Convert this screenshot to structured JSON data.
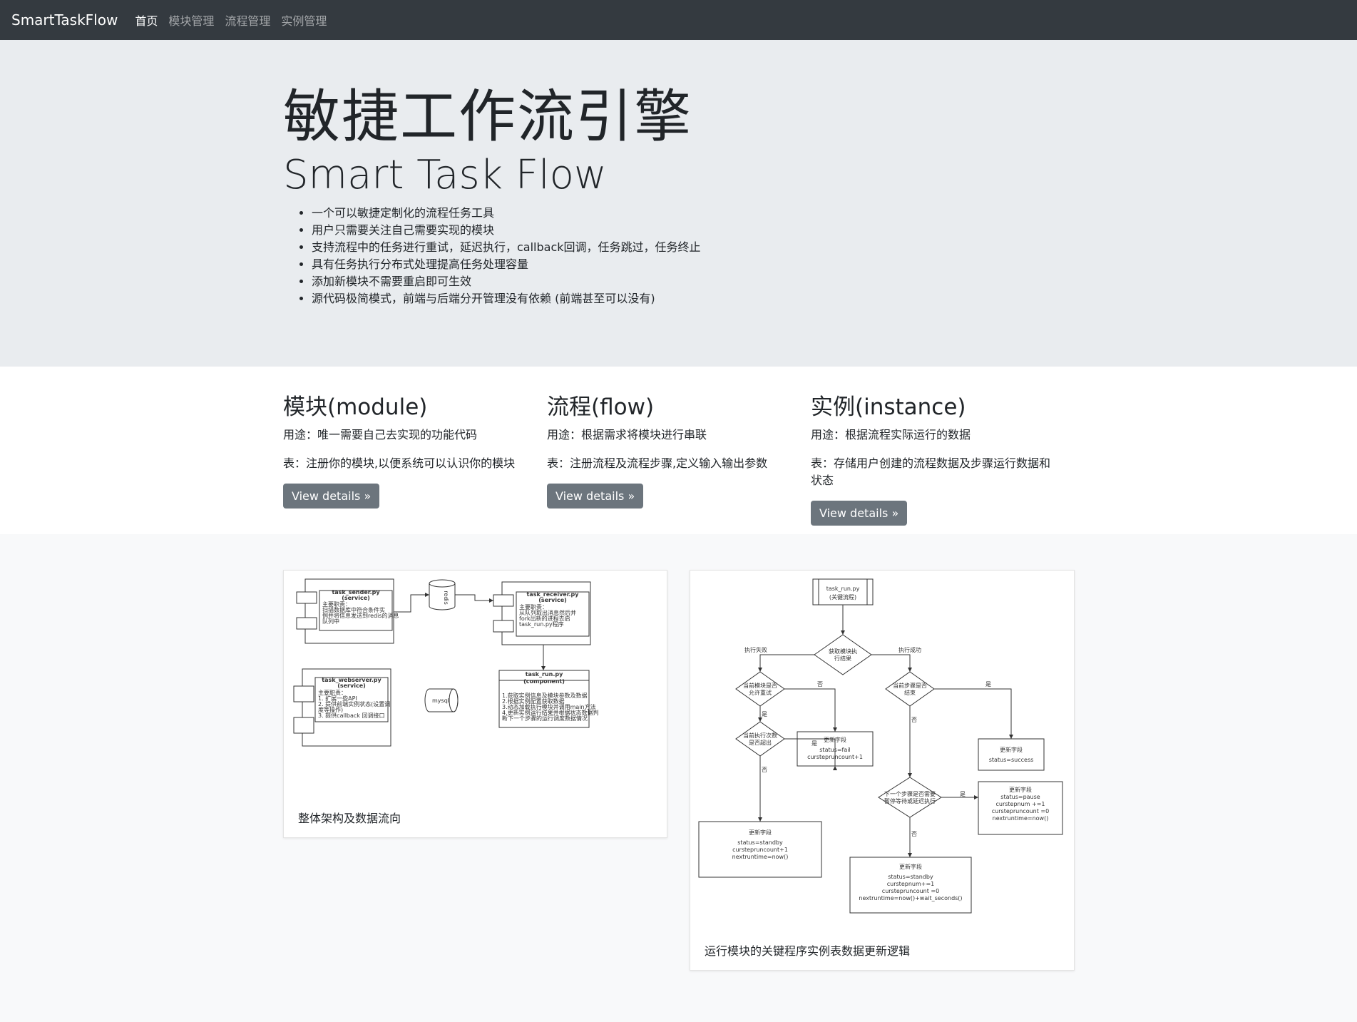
{
  "navbar": {
    "brand": "SmartTaskFlow",
    "links": [
      "首页",
      "模块管理",
      "流程管理",
      "实例管理"
    ]
  },
  "jumbotron": {
    "title_cn": "敏捷工作流引擎",
    "title_en": "Smart Task Flow",
    "features": [
      "一个可以敏捷定制化的流程任务工具",
      "用户只需要关注自己需要实现的模块",
      "支持流程中的任务进行重试，延迟执行，callback回调，任务跳过，任务终止",
      "具有任务执行分布式处理提高任务处理容量",
      "添加新模块不需要重启即可生效",
      "源代码极简模式，前端与后端分开管理没有依赖 (前端甚至可以没有)"
    ]
  },
  "columns": [
    {
      "title": "模块(module)",
      "usage": "用途：唯一需要自己去实现的功能代码",
      "table": "表：注册你的模块,以便系统可以认识你的模块",
      "button": "View details »"
    },
    {
      "title": "流程(flow)",
      "usage": "用途：根据需求将模块进行串联",
      "table": "表：注册流程及流程步骤,定义输入输出参数",
      "button": "View details »"
    },
    {
      "title": "实例(instance)",
      "usage": "用途：根据流程实际运行的数据",
      "table": "表：存储用户创建的流程数据及步骤运行数据和状态",
      "button": "View details »"
    }
  ],
  "figures": {
    "architecture": {
      "caption": "整体架构及数据流向",
      "sender_title": "task_sender.py",
      "sender_sub": "(service)",
      "sender_body": [
        "主要职责：",
        "扫描数据库中符合条件实",
        "例并将信息发送到redis的消息",
        "队列中"
      ],
      "redis": "redis",
      "receiver_title": "task_receiver.py",
      "receiver_sub": "(service)",
      "receiver_body": [
        "主要职责：",
        "从队列取出消息然后并",
        "fork出新的进程去启",
        "task_run.py程序"
      ],
      "webserver_title": "task_webserver.py",
      "webserver_sub": "(service)",
      "webserver_body": [
        "主要职责：",
        "1. 扩展一些API",
        "2. 提供前端实例状态(设置调",
        "   度等操作)",
        "3. 提供callback 回调接口"
      ],
      "mysql": "mysql",
      "run_title": "task_run.py",
      "run_sub": "(component)",
      "run_body": [
        "1.获取实例信息及模块参数及数据",
        "2.根据实例配置获取数据",
        "3.动态加载执行模块并调用main方法",
        "4.更新实例运行结果并根据状态数据判",
        "断下一个步骤的运行调度数据情况"
      ]
    },
    "logic": {
      "caption": "运行模块的关键程序实例表数据更新逻辑",
      "top_box": [
        "task_run.py",
        "(关键流程)"
      ],
      "decision_main": [
        "获取模块执",
        "行结果"
      ],
      "fail_label": "执行失败",
      "success_label": "执行成功",
      "decision_retry": [
        "当前模块是否",
        "允许重试"
      ],
      "decision_last": [
        "当前步骤是否",
        "结束"
      ],
      "decision_count": [
        "当前执行次数",
        "是否超出"
      ],
      "decision_next": [
        "下一个步骤是否需要",
        "暂停等待或延迟执行"
      ],
      "yes": "是",
      "no": "否",
      "box_fail": [
        "更新字段",
        "status=fail",
        "curstepruncount+1"
      ],
      "box_success": [
        "更新字段",
        "status=success"
      ],
      "box_pause": [
        "更新字段",
        "status=pause",
        "curstepnum +=1",
        "curstepruncount =0",
        "nextruntime=now()"
      ],
      "box_standby1": [
        "更新字段",
        "status=standby",
        "curstepruncount+1",
        "nextruntime=now()"
      ],
      "box_standby2": [
        "更新字段",
        "status=standby",
        "curstepnum+=1",
        "curstepruncount =0",
        "nextruntime=now()+wait_seconds()"
      ]
    }
  }
}
